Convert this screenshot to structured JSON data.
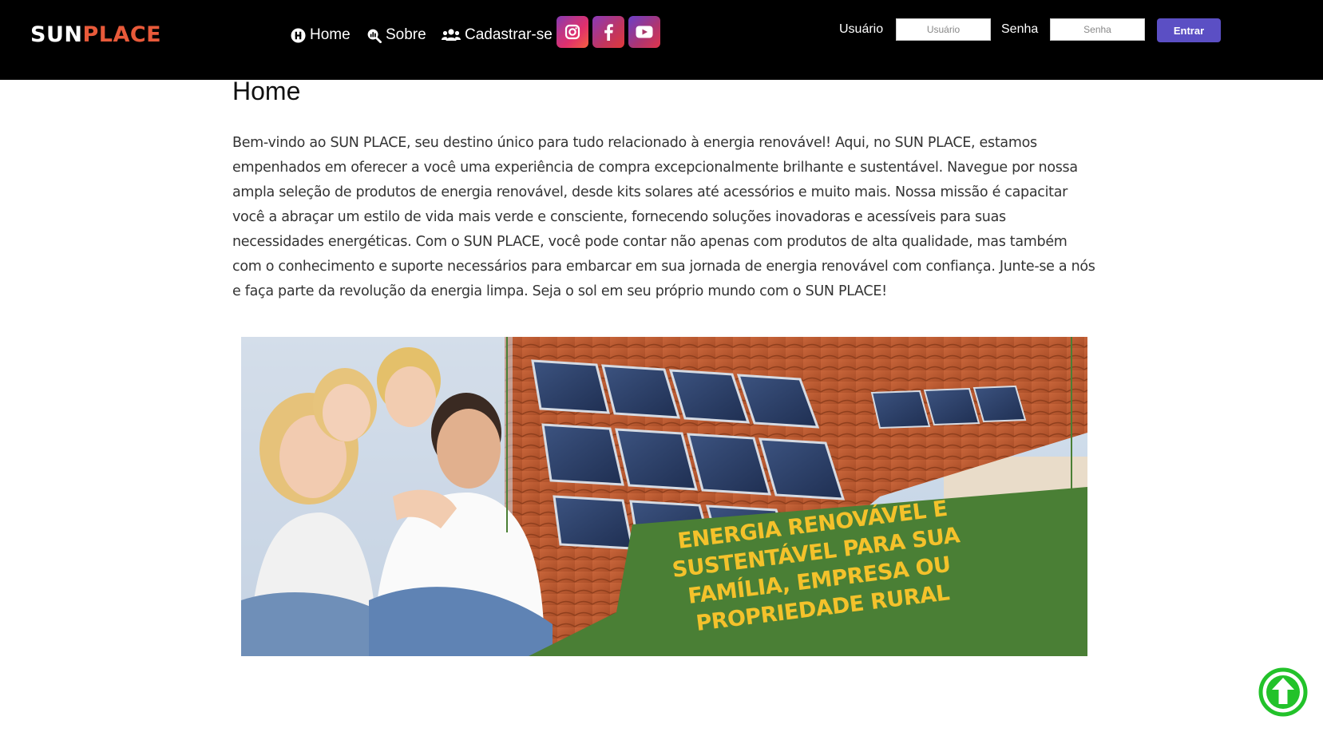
{
  "brand": {
    "part1": "SUN",
    "part2": "PLACE",
    "part1_color": "#ffffff",
    "part2_color": "#e85a3a"
  },
  "nav": {
    "items": [
      {
        "label": "Home",
        "icon": "home-circle-icon"
      },
      {
        "label": "Sobre",
        "icon": "search-chart-icon"
      },
      {
        "label": "Cadastrar-se",
        "icon": "users-icon"
      }
    ],
    "social": [
      {
        "name": "Instagram",
        "icon": "instagram-icon"
      },
      {
        "name": "Facebook",
        "icon": "facebook-icon"
      },
      {
        "name": "YouTube",
        "icon": "youtube-icon"
      }
    ]
  },
  "login": {
    "user_label": "Usuário",
    "user_placeholder": "Usuário",
    "pass_label": "Senha",
    "pass_placeholder": "Senha",
    "submit_label": "Entrar",
    "submit_color": "#5b4fc4"
  },
  "main": {
    "title": "Home",
    "intro": "Bem-vindo ao SUN PLACE, seu destino único para tudo relacionado à energia renovável! Aqui, no SUN PLACE, estamos empenhados em oferecer a você uma experiência de compra excepcionalmente brilhante e sustentável. Navegue por nossa ampla seleção de produtos de energia renovável, desde kits solares até acessórios e muito mais. Nossa missão é capacitar você a abraçar um estilo de vida mais verde e consciente, fornecendo soluções inovadoras e acessíveis para suas necessidades energéticas. Com o SUN PLACE, você pode contar não apenas com produtos de alta qualidade, mas também com o conhecimento e suporte necessários para embarcar em sua jornada de energia renovável com confiança. Junte-se a nós e faça parte da revolução da energia limpa. Seja o sol em seu próprio mundo com o SUN PLACE!",
    "banner": {
      "headline": "Energia renovável e sustentável para sua família, empresa ou propriedade rural",
      "ribbon_color": "#4a7f35",
      "text_color": "#f4c22b"
    }
  },
  "back_to_top": {
    "icon": "arrow-up-circle-icon",
    "color": "#22c22a"
  }
}
